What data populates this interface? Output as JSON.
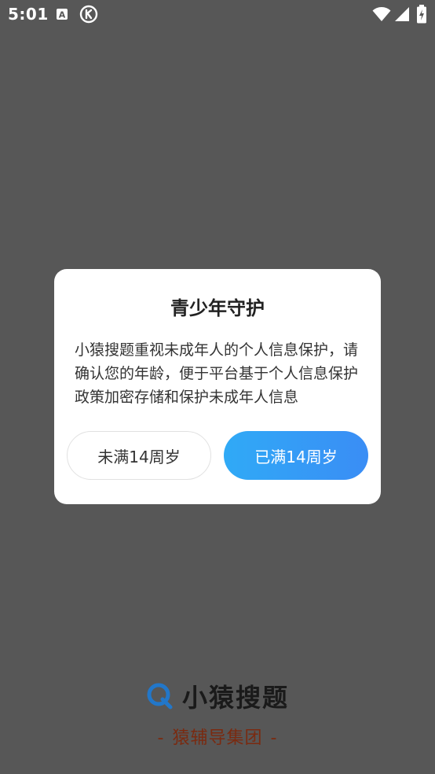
{
  "status_bar": {
    "time": "5:01",
    "icons": [
      "font-a-icon",
      "k-circle-icon",
      "wifi-icon",
      "signal-icon",
      "battery-icon"
    ]
  },
  "dialog": {
    "title": "青少年守护",
    "body": "小猿搜题重视未成年人的个人信息保护，请确认您的年龄，便于平台基于个人信息保护政策加密存储和保护未成年人信息",
    "under_14_label": "未满14周岁",
    "over_14_label": "已满14周岁"
  },
  "brand": {
    "app_name": "小猿搜题",
    "subtitle": "猿辅导集团",
    "dash": "-"
  },
  "colors": {
    "overlay": "#575757",
    "primary_gradient_start": "#30aaf6",
    "primary_gradient_end": "#3a8df5",
    "logo_blue": "#2277c9",
    "subtitle_brown": "#7a2a10"
  }
}
